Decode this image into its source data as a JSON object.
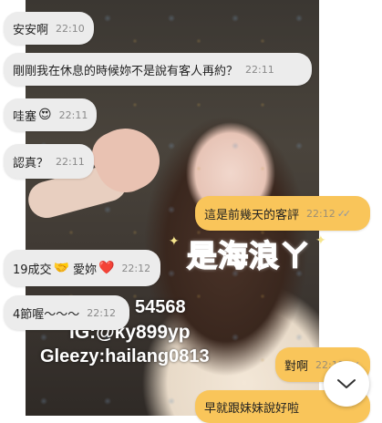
{
  "background_overlay": {
    "pink_title": "是海浪ㄚ",
    "line1": "54568",
    "line2": "IG:@ky899yp",
    "line3": "Gleezy:hailang0813"
  },
  "messages": [
    {
      "direction": "in",
      "text": "安安啊",
      "time": "22:10"
    },
    {
      "direction": "in",
      "text": "剛剛我在休息的時候妳不是說有客人再約？",
      "time": "22:11"
    },
    {
      "direction": "in",
      "text": "哇塞",
      "emoji": "😍",
      "time": "22:11"
    },
    {
      "direction": "in",
      "text": "認真？",
      "time": "22:11"
    },
    {
      "direction": "out",
      "text": "這是前幾天的客評",
      "time": "22:12",
      "read": "✓✓"
    },
    {
      "direction": "in",
      "text": "19成交",
      "emoji": "🤝",
      "text2": "愛妳",
      "emoji2": "❤️",
      "time": "22:12"
    },
    {
      "direction": "in",
      "text": "4節喔～～～",
      "time": "22:12"
    },
    {
      "direction": "out",
      "text": "對啊",
      "time": "22:12",
      "read": "✓✓"
    },
    {
      "direction": "out",
      "text": "早就跟妹妹說好啦",
      "time": "",
      "read": ""
    }
  ],
  "icons": {
    "scroll_down": "chevron-down-icon",
    "sparkle": "sparkle-icon"
  },
  "colors": {
    "incoming_bubble": "#ececec",
    "outgoing_bubble": "#f9c55a",
    "title_pink": "#f3a7c3"
  }
}
